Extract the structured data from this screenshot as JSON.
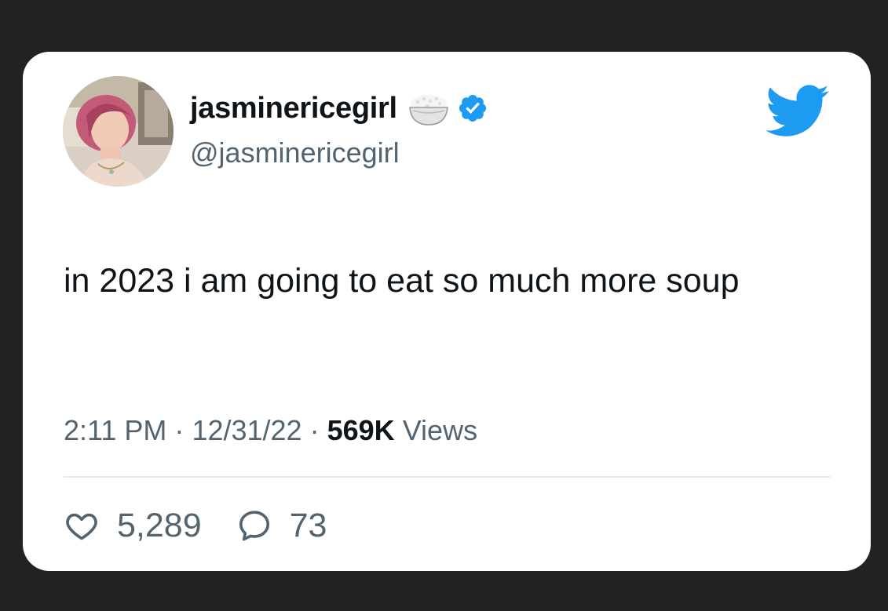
{
  "tweet": {
    "display_name": "jasminericegirl",
    "handle": "@jasminericegirl",
    "text": "in 2023 i am going to eat so much more soup",
    "time": "2:11 PM",
    "separator": "·",
    "date": "12/31/22",
    "views_count": "569K",
    "views_label": "Views",
    "likes": "5,289",
    "replies": "73"
  },
  "icons": {
    "name_emoji": "rice-bowl-icon",
    "verified": "verified-badge-icon",
    "brand": "twitter-bird-icon",
    "like": "heart-icon",
    "reply": "speech-bubble-icon"
  },
  "colors": {
    "background": "#222222",
    "card": "#ffffff",
    "primary_text": "#0f1419",
    "secondary_text": "#536471",
    "twitter_blue": "#1d9bf0"
  }
}
